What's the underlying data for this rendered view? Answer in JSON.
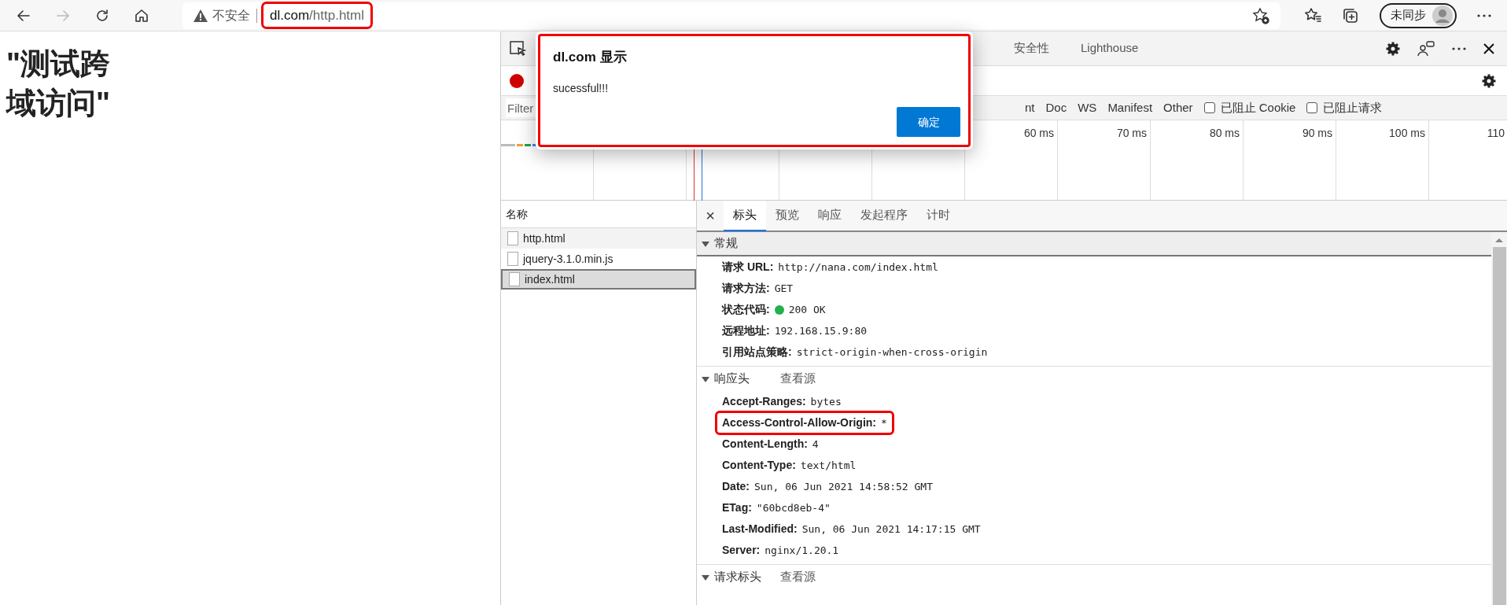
{
  "browser": {
    "security_label": "不安全",
    "url_host": "dl.com",
    "url_path": "/http.html",
    "url_highlighted": true,
    "profile_label": "未同步"
  },
  "page": {
    "heading": "\"测试跨域访问\""
  },
  "devtools": {
    "tabs": [
      {
        "label": "安全性",
        "selected": false
      },
      {
        "label": "Lighthouse",
        "selected": false
      }
    ],
    "recording": true,
    "filter_placeholder": "Filter",
    "type_filters": [
      "nt",
      "Doc",
      "WS",
      "Manifest",
      "Other"
    ],
    "checkboxes": [
      {
        "label": "已阻止 Cookie",
        "checked": false
      },
      {
        "label": "已阻止请求",
        "checked": false
      }
    ],
    "timeline_ticks": [
      "60 ms",
      "70 ms",
      "80 ms",
      "90 ms",
      "100 ms",
      "110"
    ]
  },
  "requests": {
    "column": "名称",
    "items": [
      {
        "name": "http.html",
        "selected": false
      },
      {
        "name": "jquery-3.1.0.min.js",
        "selected": false
      },
      {
        "name": "index.html",
        "selected": true
      }
    ]
  },
  "details": {
    "close": "×",
    "tabs": [
      {
        "label": "标头",
        "selected": true
      },
      {
        "label": "预览",
        "selected": false
      },
      {
        "label": "响应",
        "selected": false
      },
      {
        "label": "发起程序",
        "selected": false
      },
      {
        "label": "计时",
        "selected": false
      }
    ],
    "sections": [
      {
        "title": "常规",
        "expanded": true,
        "rows": [
          {
            "key": "请求 URL:",
            "value": "http://nana.com/index.html",
            "kind": "plain",
            "highlighted": false
          },
          {
            "key": "请求方法:",
            "value": "GET",
            "kind": "plain",
            "highlighted": false
          },
          {
            "key": "状态代码:",
            "value": "200 OK",
            "kind": "status",
            "highlighted": false
          },
          {
            "key": "远程地址:",
            "value": "192.168.15.9:80",
            "kind": "plain",
            "highlighted": false
          },
          {
            "key": "引用站点策略:",
            "value": "strict-origin-when-cross-origin",
            "kind": "plain",
            "highlighted": false
          }
        ]
      },
      {
        "title": "响应头",
        "link": "查看源",
        "expanded": true,
        "rows": [
          {
            "key": "Accept-Ranges:",
            "value": "bytes",
            "kind": "plain",
            "highlighted": false
          },
          {
            "key": "Access-Control-Allow-Origin:",
            "value": "*",
            "kind": "plain",
            "highlighted": true
          },
          {
            "key": "Content-Length:",
            "value": "4",
            "kind": "plain",
            "highlighted": false
          },
          {
            "key": "Content-Type:",
            "value": "text/html",
            "kind": "plain",
            "highlighted": false
          },
          {
            "key": "Date:",
            "value": "Sun, 06 Jun 2021 14:58:52 GMT",
            "kind": "plain",
            "highlighted": false
          },
          {
            "key": "ETag:",
            "value": "\"60bcd8eb-4\"",
            "kind": "plain",
            "highlighted": false
          },
          {
            "key": "Last-Modified:",
            "value": "Sun, 06 Jun 2021 14:17:15 GMT",
            "kind": "plain",
            "highlighted": false
          },
          {
            "key": "Server:",
            "value": "nginx/1.20.1",
            "kind": "plain",
            "highlighted": false
          }
        ]
      },
      {
        "title": "请求标头",
        "link": "查看源",
        "expanded": true
      }
    ]
  },
  "dialog": {
    "title": "dl.com 显示",
    "message": "sucessful!!!",
    "button": "确定",
    "highlighted": true
  }
}
